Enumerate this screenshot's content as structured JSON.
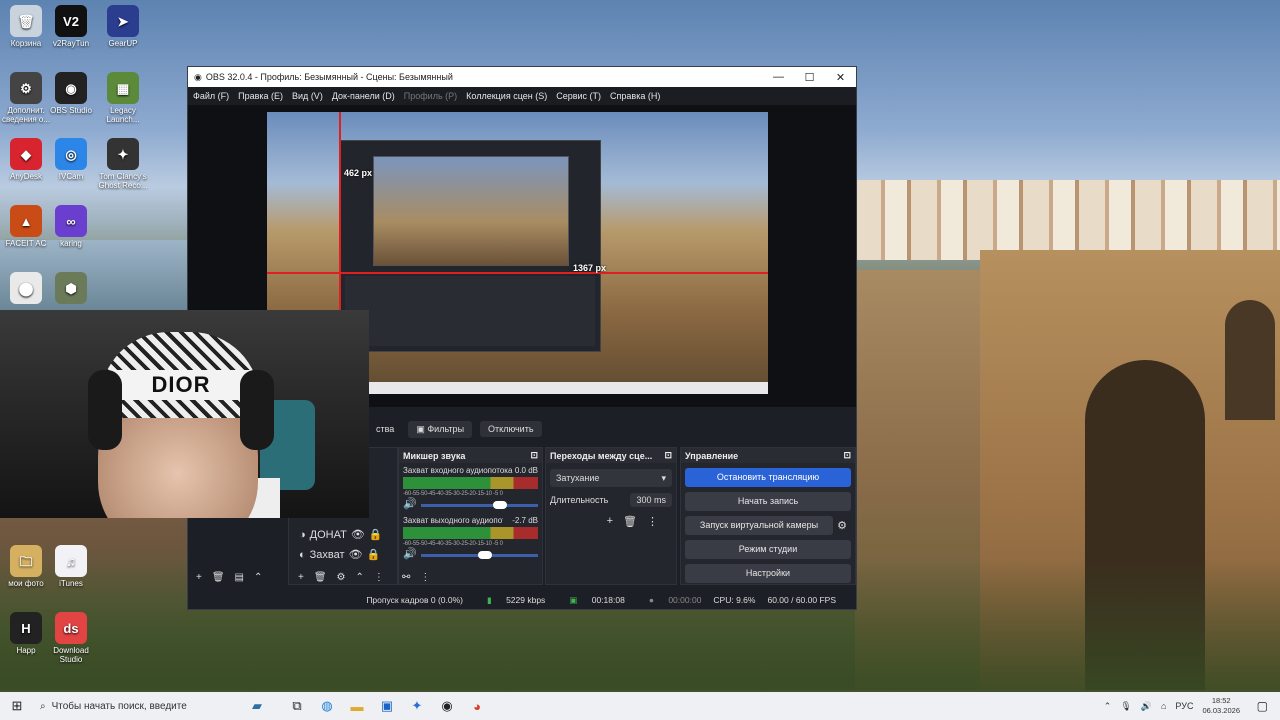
{
  "desktop_icons": [
    {
      "label": "Корзина",
      "glyph": "🗑",
      "color": "#c9d3de"
    },
    {
      "label": "v2RayTun",
      "glyph": "V2",
      "color": "#111"
    },
    {
      "label": "GearUP",
      "glyph": "➤",
      "color": "#2a3d8f"
    },
    {
      "label": "Дополнит. сведения о...",
      "glyph": "⚙",
      "color": "#444"
    },
    {
      "label": "OBS Studio",
      "glyph": "◉",
      "color": "#222"
    },
    {
      "label": "Legacy Launch...",
      "glyph": "▦",
      "color": "#5a8a3a"
    },
    {
      "label": "AnyDesk",
      "glyph": "◆",
      "color": "#d8242f"
    },
    {
      "label": "IVCam",
      "glyph": "◎",
      "color": "#2c86e8"
    },
    {
      "label": "Tom Clancy's Ghost Reco...",
      "glyph": "✦",
      "color": "#333"
    },
    {
      "label": "FACEIT AC",
      "glyph": "▲",
      "color": "#c94b16"
    },
    {
      "label": "karing",
      "glyph": "∞",
      "color": "#6a3fd0"
    },
    {
      "label": "",
      "glyph": "⬤",
      "color": "#e9e9e9"
    },
    {
      "label": "",
      "glyph": "⬢",
      "color": "#6b7b5a"
    },
    {
      "label": "мои фото",
      "glyph": "🗀",
      "color": "#d5b061"
    },
    {
      "label": "iTunes",
      "glyph": "♫",
      "color": "#f2f2f6"
    },
    {
      "label": "Happ",
      "glyph": "H",
      "color": "#222"
    },
    {
      "label": "Download Studio",
      "glyph": "ds",
      "color": "#e24343"
    }
  ],
  "obs": {
    "title": "OBS 32.0.4 - Профиль: Безымянный - Сцены: Безымянный",
    "window_controls": {
      "minimize": "—",
      "maximize": "☐",
      "close": "✕"
    },
    "menu": [
      "Файл (F)",
      "Правка (E)",
      "Вид (V)",
      "Док-панели (D)",
      "Профиль (P)",
      "Коллекция сцен (S)",
      "Сервис (T)",
      "Справка (H)"
    ],
    "preview": {
      "px_label_a": "462 px",
      "px_label_b": "1367 px"
    },
    "source_toolbar": {
      "properties": "ства",
      "filters": "Фильтры",
      "disable": "Отключить"
    },
    "sources": [
      {
        "name": "ДОНАТ"
      },
      {
        "name": "Захват"
      }
    ],
    "mixer": {
      "title": "Микшер звука",
      "ticks": "-60-55-50-45-40-35-30-25-20-15-10 -5 0",
      "channels": [
        {
          "name": "Захват входного аудиопотока",
          "db": "0.0 dB",
          "level": 0.68
        },
        {
          "name": "Захват выходного аудиопотока",
          "db": "-2.7 dB",
          "level": 0.55
        }
      ]
    },
    "transitions": {
      "title": "Переходы между сце...",
      "selected": "Затухание",
      "duration_label": "Длительность",
      "duration_value": "300 ms"
    },
    "controls": {
      "title": "Управление",
      "stop_stream": "Остановить трансляцию",
      "start_record": "Начать запись",
      "virtual_cam": "Запуск виртуальной камеры",
      "studio_mode": "Режим студии",
      "settings": "Настройки"
    },
    "status": {
      "dropped": "Пропуск кадров 0 (0.0%)",
      "bitrate": "5229 kbps",
      "stream_time": "00:18:08",
      "record_time": "00:00:00",
      "cpu": "CPU: 9.6%",
      "fps": "60.00 / 60.00 FPS"
    }
  },
  "taskbar": {
    "search_placeholder": "Чтобы начать поиск, введите",
    "lang": "РУС",
    "time": "18:52",
    "date": "06.03.2026"
  },
  "colors": {
    "accent": "#2a63d8",
    "live": "#3fb34f"
  }
}
